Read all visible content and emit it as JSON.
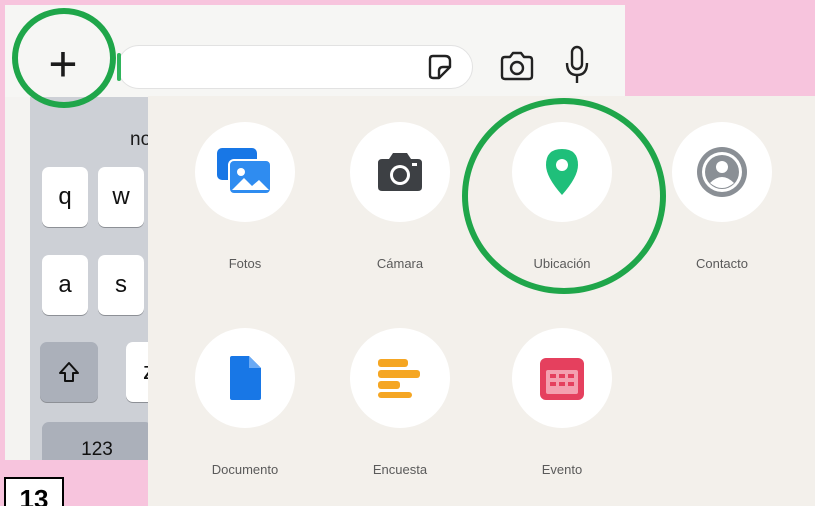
{
  "input_bar": {
    "plus_label": "+",
    "icons": [
      "sticker-icon",
      "camera-icon",
      "microphone-icon"
    ]
  },
  "keyboard": {
    "suggestion": "no",
    "row1": [
      "q",
      "w"
    ],
    "row2": [
      "a",
      "s"
    ],
    "row3_partial": "z",
    "numbers_key": "123"
  },
  "attach_menu": {
    "options": [
      {
        "label": "Fotos",
        "icon": "photos-icon"
      },
      {
        "label": "Cámara",
        "icon": "camera-icon"
      },
      {
        "label": "Ubicación",
        "icon": "location-pin-icon"
      },
      {
        "label": "Contacto",
        "icon": "contact-icon"
      },
      {
        "label": "Documento",
        "icon": "document-icon"
      },
      {
        "label": "Encuesta",
        "icon": "poll-icon"
      },
      {
        "label": "Evento",
        "icon": "calendar-icon"
      }
    ]
  },
  "highlight_color": "#1fa64a",
  "step_number": "13"
}
